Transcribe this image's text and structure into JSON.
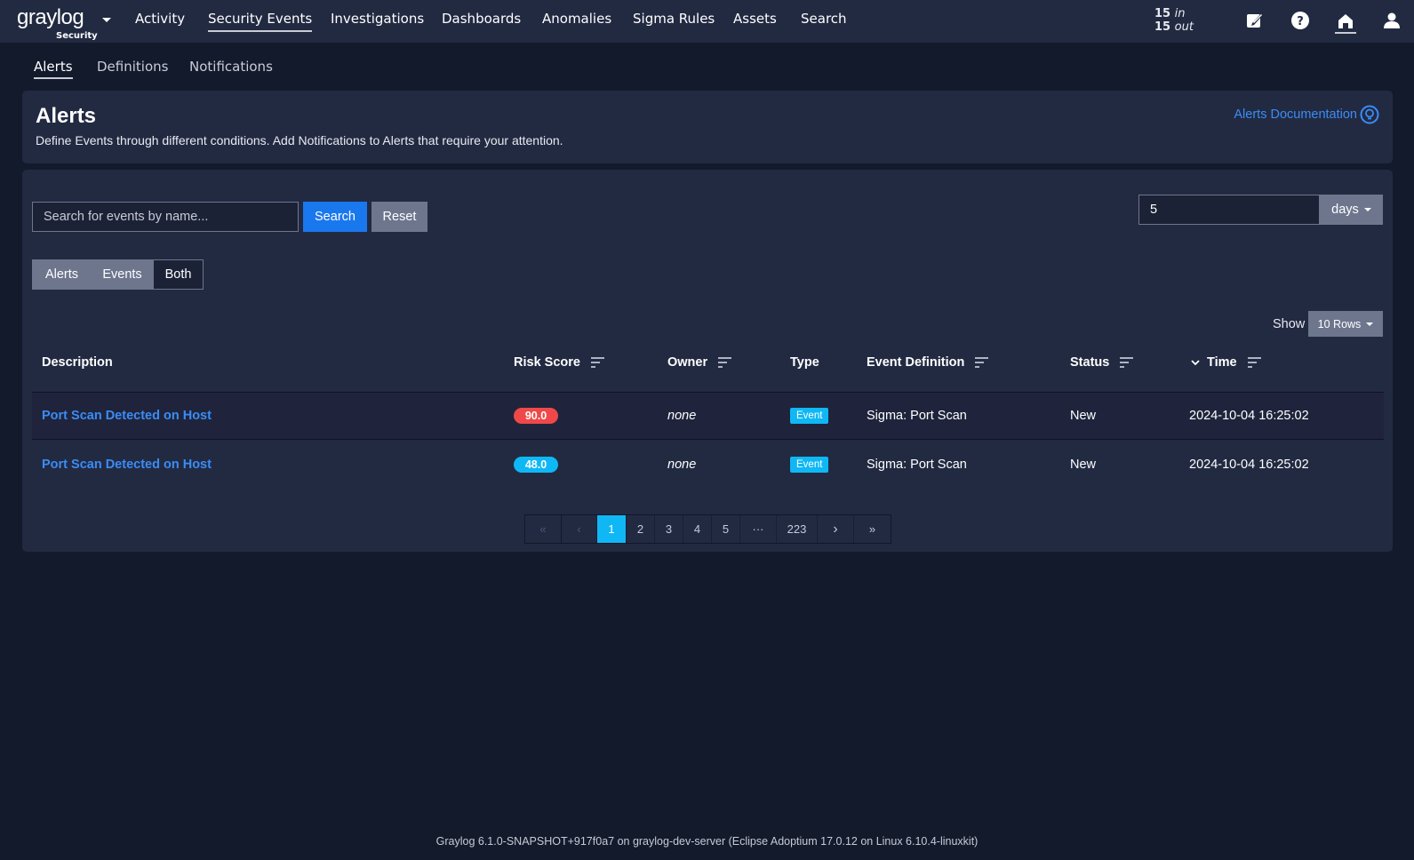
{
  "topnav": {
    "logo": "graylog",
    "logo_sub": "Security",
    "items": [
      "Activity",
      "Security Events",
      "Investigations",
      "Dashboards",
      "Anomalies",
      "Sigma Rules",
      "Assets",
      "Search"
    ],
    "throughput_in_value": "15",
    "throughput_in_label": "in",
    "throughput_out_value": "15",
    "throughput_out_label": "out"
  },
  "subnav": [
    "Alerts",
    "Definitions",
    "Notifications"
  ],
  "header": {
    "title": "Alerts",
    "description": "Define Events through different conditions. Add Notifications to Alerts that require your attention.",
    "doc_link": "Alerts Documentation"
  },
  "filters": {
    "search_placeholder": "Search for events by name...",
    "search_button": "Search",
    "reset_button": "Reset",
    "range_value": "5",
    "range_unit": "days",
    "segments": [
      "Alerts",
      "Events",
      "Both"
    ],
    "selected_segment": "Both",
    "show_label": "Show",
    "rows_option": "10 Rows"
  },
  "table": {
    "columns": [
      "Description",
      "Risk Score",
      "Owner",
      "Type",
      "Event Definition",
      "Status",
      "Time"
    ],
    "rows": [
      {
        "description": "Port Scan Detected on Host",
        "risk": "90.0",
        "risk_color": "#f04848",
        "owner": "none",
        "type": "Event",
        "definition": "Sigma: Port Scan",
        "status": "New",
        "time": "2024-10-04 16:25:02"
      },
      {
        "description": "Port Scan Detected on Host",
        "risk": "48.0",
        "risk_color": "#0fb8f5",
        "owner": "none",
        "type": "Event",
        "definition": "Sigma: Port Scan",
        "status": "New",
        "time": "2024-10-04 16:25:02"
      }
    ]
  },
  "pagination": {
    "first": "«",
    "prev": "‹",
    "pages": [
      "1",
      "2",
      "3",
      "4",
      "5"
    ],
    "ellipsis": "···",
    "last_page": "223",
    "next": "›",
    "last": "»",
    "current": "1"
  },
  "footer": "Graylog 6.1.0-SNAPSHOT+917f0a7 on graylog-dev-server (Eclipse Adoptium 17.0.12 on Linux 6.10.4-linuxkit)"
}
